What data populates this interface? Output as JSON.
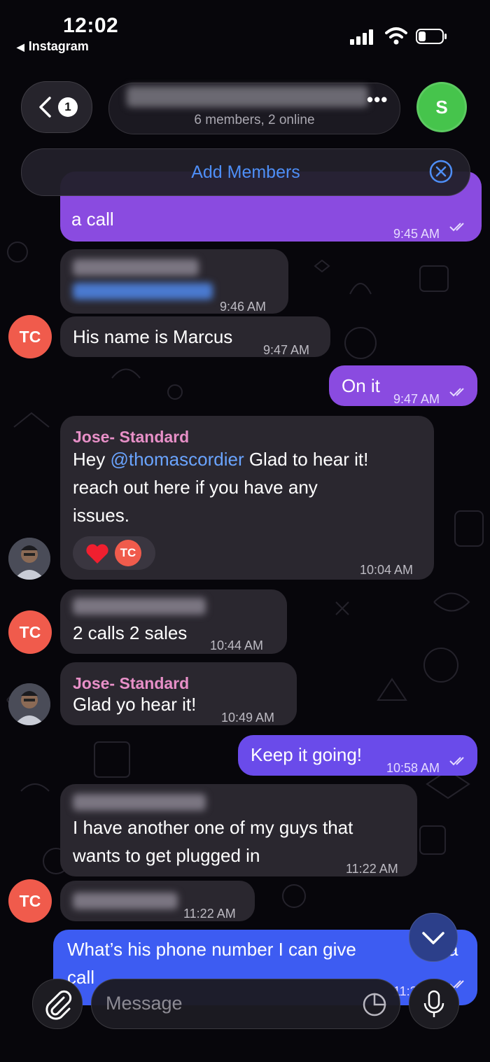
{
  "status_bar": {
    "time": "12:02",
    "back_app": "Instagram"
  },
  "header": {
    "back_badge": "1",
    "title_menu": "•••",
    "subtitle": "6 members, 2 online",
    "avatar_initial": "S"
  },
  "add_members": {
    "label": "Add Members"
  },
  "messages": [
    {
      "kind": "outgoing",
      "text": "a call",
      "time": "9:45 AM"
    },
    {
      "kind": "incoming",
      "time": "9:46 AM"
    },
    {
      "kind": "incoming",
      "avatar": "TC",
      "text": "His name is Marcus",
      "time": "9:47 AM"
    },
    {
      "kind": "outgoing",
      "text": "On it",
      "time": "9:47 AM"
    },
    {
      "kind": "incoming",
      "sender": "Jose- Standard",
      "line1_a": "Hey ",
      "mention": "@thomascordier",
      "line1_b": " Glad to hear it!",
      "line2": "reach out here if you have any",
      "line3": "issues.",
      "reaction_avatar": "TC",
      "time": "10:04 AM"
    },
    {
      "kind": "incoming",
      "avatar": "TC",
      "text": "2 calls 2 sales",
      "time": "10:44 AM"
    },
    {
      "kind": "incoming",
      "sender": "Jose- Standard",
      "text": "Glad yo hear it!",
      "time": "10:49 AM"
    },
    {
      "kind": "outgoing",
      "text": "Keep it going!",
      "time": "10:58 AM"
    },
    {
      "kind": "incoming",
      "line1": "I have another one of my guys that",
      "line2": "wants to get plugged in",
      "time": "11:22 AM"
    },
    {
      "kind": "incoming",
      "avatar": "TC",
      "time": "11:22 AM"
    },
    {
      "kind": "outgoing",
      "line1": "What’s his phone number I can give",
      "line1_tail": "a",
      "line2": "call",
      "time": "11:2"
    }
  ],
  "composer": {
    "placeholder": "Message"
  },
  "colors": {
    "outgoing": "#8a4be0",
    "incoming": "#2a272f",
    "accent": "#4e8ef6",
    "sender": "#e890c8"
  }
}
